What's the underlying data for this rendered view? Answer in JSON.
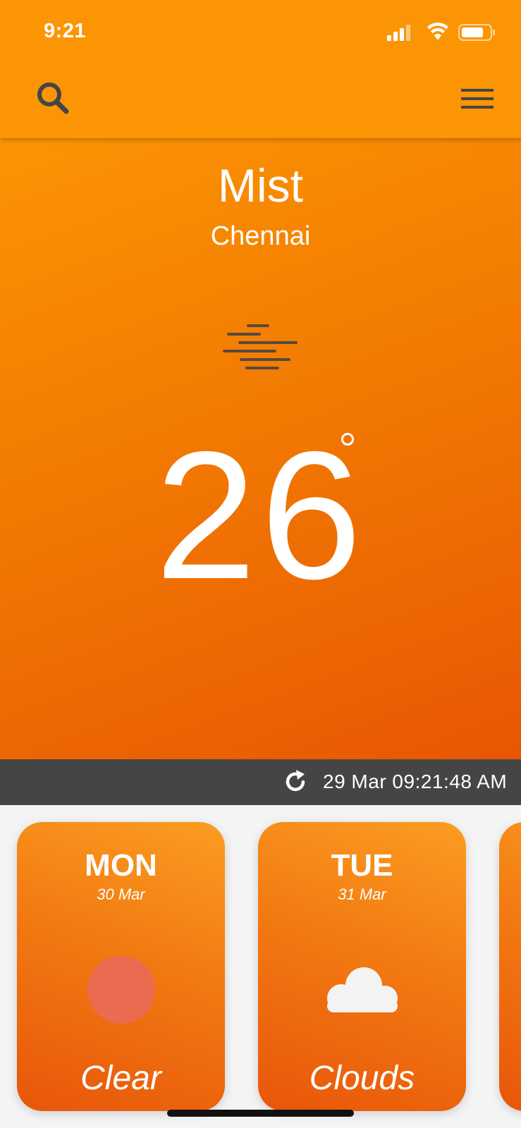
{
  "status_bar": {
    "time": "9:21"
  },
  "header": {
    "search_icon": "search-icon",
    "menu_icon": "hamburger-menu-icon"
  },
  "current": {
    "condition": "Mist",
    "city": "Chennai",
    "icon": "mist-icon",
    "temperature": "26",
    "degree_symbol": "°"
  },
  "update_bar": {
    "refresh_icon": "refresh-icon",
    "last_updated": "29 Mar 09:21:48 AM"
  },
  "forecast": [
    {
      "day": "MON",
      "date": "30 Mar",
      "icon": "sun-icon",
      "condition": "Clear"
    },
    {
      "day": "TUE",
      "date": "31 Mar",
      "icon": "cloud-icon",
      "condition": "Clouds"
    }
  ],
  "colors": {
    "primary": "#fc9504",
    "hero_dark": "#e85703",
    "update_bar": "#454545",
    "icon_dark": "#454545",
    "sun": "#ea6b4f"
  }
}
